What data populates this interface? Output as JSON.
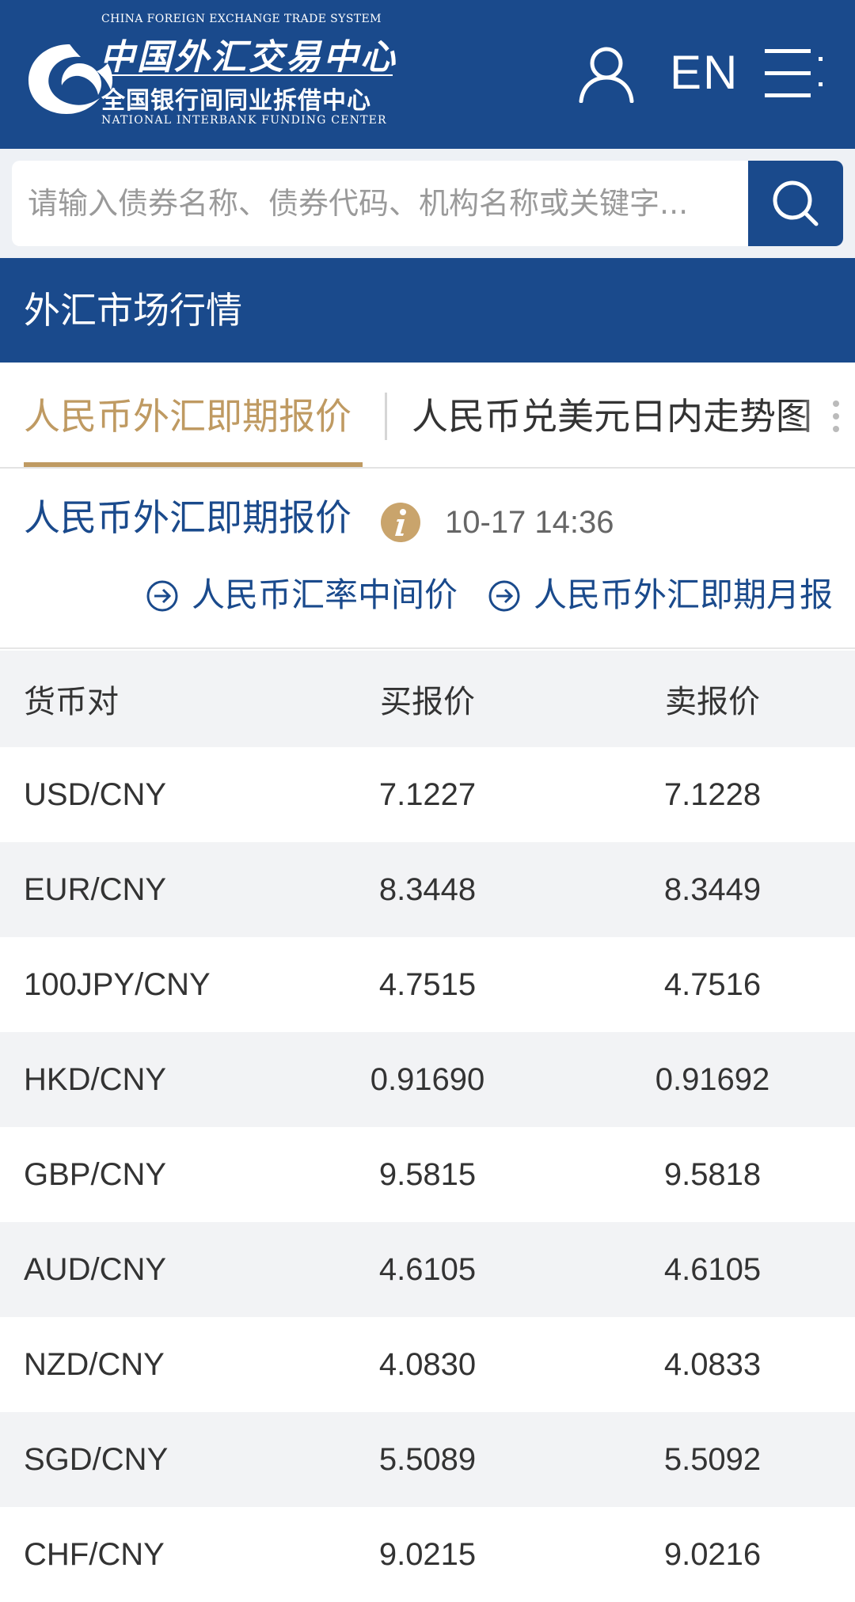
{
  "header": {
    "logo": {
      "en_top": "CHINA FOREIGN EXCHANGE TRADE SYSTEM",
      "cn_main": "中国外汇交易中心",
      "cn_sub": "全国银行间同业拆借中心",
      "en_bottom": "NATIONAL INTERBANK FUNDING CENTER"
    },
    "lang_label": "EN",
    "icons": [
      "logo-mark",
      "user-icon",
      "menu-icon"
    ]
  },
  "search": {
    "placeholder": "请输入债券名称、债券代码、机构名称或关键字...",
    "button_icon": "search-icon"
  },
  "section": {
    "title": "外汇市场行情"
  },
  "tabs": [
    {
      "label": "人民币外汇即期报价",
      "active": true
    },
    {
      "label": "人民币兑美元日内走势图",
      "active": false
    }
  ],
  "quote": {
    "title": "人民币外汇即期报价",
    "time": "10-17 14:36",
    "links": [
      {
        "label": "人民币汇率中间价",
        "icon": "arrow-right-circle-icon"
      },
      {
        "label": "人民币外汇即期月报",
        "icon": "arrow-right-circle-icon"
      }
    ]
  },
  "table": {
    "columns": [
      "货币对",
      "买报价",
      "卖报价"
    ],
    "rows": [
      {
        "pair": "USD/CNY",
        "bid": "7.1227",
        "ask": "7.1228"
      },
      {
        "pair": "EUR/CNY",
        "bid": "8.3448",
        "ask": "8.3449"
      },
      {
        "pair": "100JPY/CNY",
        "bid": "4.7515",
        "ask": "4.7516"
      },
      {
        "pair": "HKD/CNY",
        "bid": "0.91690",
        "ask": "0.91692"
      },
      {
        "pair": "GBP/CNY",
        "bid": "9.5815",
        "ask": "9.5818"
      },
      {
        "pair": "AUD/CNY",
        "bid": "4.6105",
        "ask": "4.6105"
      },
      {
        "pair": "NZD/CNY",
        "bid": "4.0830",
        "ask": "4.0833"
      },
      {
        "pair": "SGD/CNY",
        "bid": "5.5089",
        "ask": "5.5092"
      },
      {
        "pair": "CHF/CNY",
        "bid": "9.0215",
        "ask": "9.0216"
      }
    ]
  },
  "colors": {
    "brand_blue": "#1a4a8c",
    "accent_gold": "#bf9a62",
    "row_alt": "#f2f3f5"
  }
}
